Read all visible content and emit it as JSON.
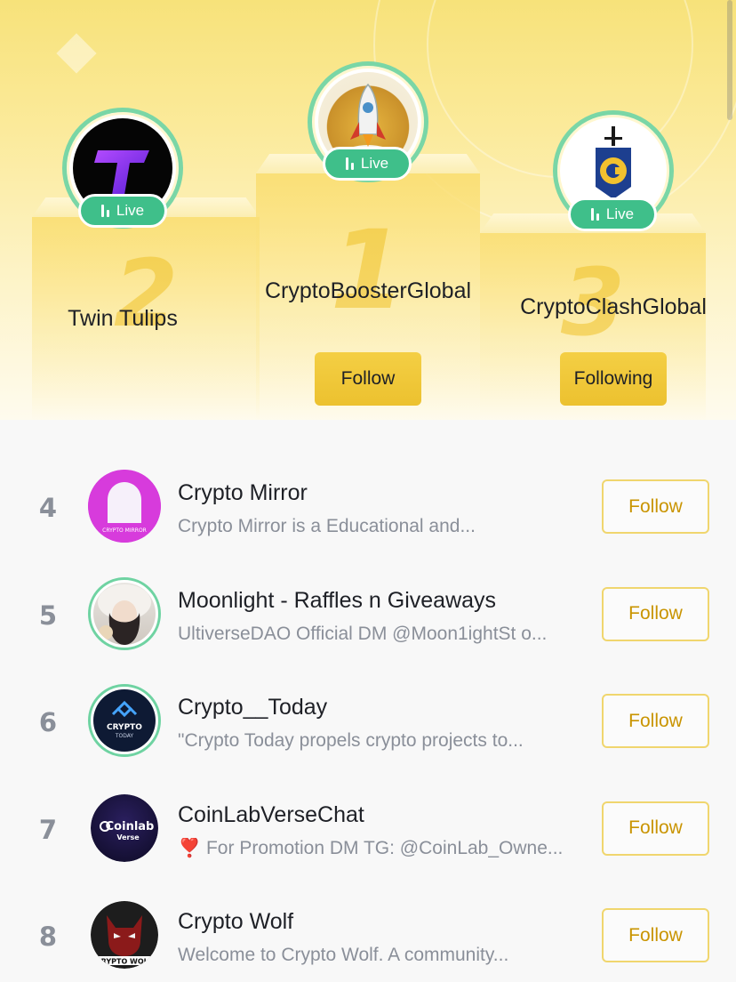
{
  "podium": {
    "live_label": "Live",
    "second": {
      "rank": "2",
      "name": "Twin Tulips"
    },
    "first": {
      "rank": "1",
      "name": "CryptoBoosterGlobal",
      "button": "Follow"
    },
    "third": {
      "rank": "3",
      "name": "CryptoClashGlobal",
      "button": "Following"
    }
  },
  "list": {
    "items": [
      {
        "rank": "4",
        "name": "Crypto Mirror",
        "desc": "Crypto Mirror is a Educational and...",
        "button": "Follow",
        "avatar_text": "CRYPTO MIRROR"
      },
      {
        "rank": "5",
        "name": "Moonlight - Raffles n Giveaways",
        "desc": "UltiverseDAO Official DM @Moon1ightSt o...",
        "button": "Follow"
      },
      {
        "rank": "6",
        "name": "Crypto__Today",
        "desc": "\"Crypto Today propels crypto projects to...",
        "button": "Follow",
        "avatar_text": "CRYPTO",
        "avatar_sub": "TODAY"
      },
      {
        "rank": "7",
        "name": "CoinLabVerseChat",
        "desc": "❣️ For Promotion DM TG: @CoinLab_Owne...",
        "button": "Follow",
        "avatar_text": "Coinlab",
        "avatar_sub": "Verse"
      },
      {
        "rank": "8",
        "name": "Crypto Wolf",
        "desc": "Welcome to Crypto Wolf. A community...",
        "button": "Follow",
        "avatar_text": "CRYPTO WOLF"
      }
    ]
  },
  "colors": {
    "accent": "#f0b90b",
    "live": "#3fbf8a",
    "follow_text": "#c99400"
  }
}
